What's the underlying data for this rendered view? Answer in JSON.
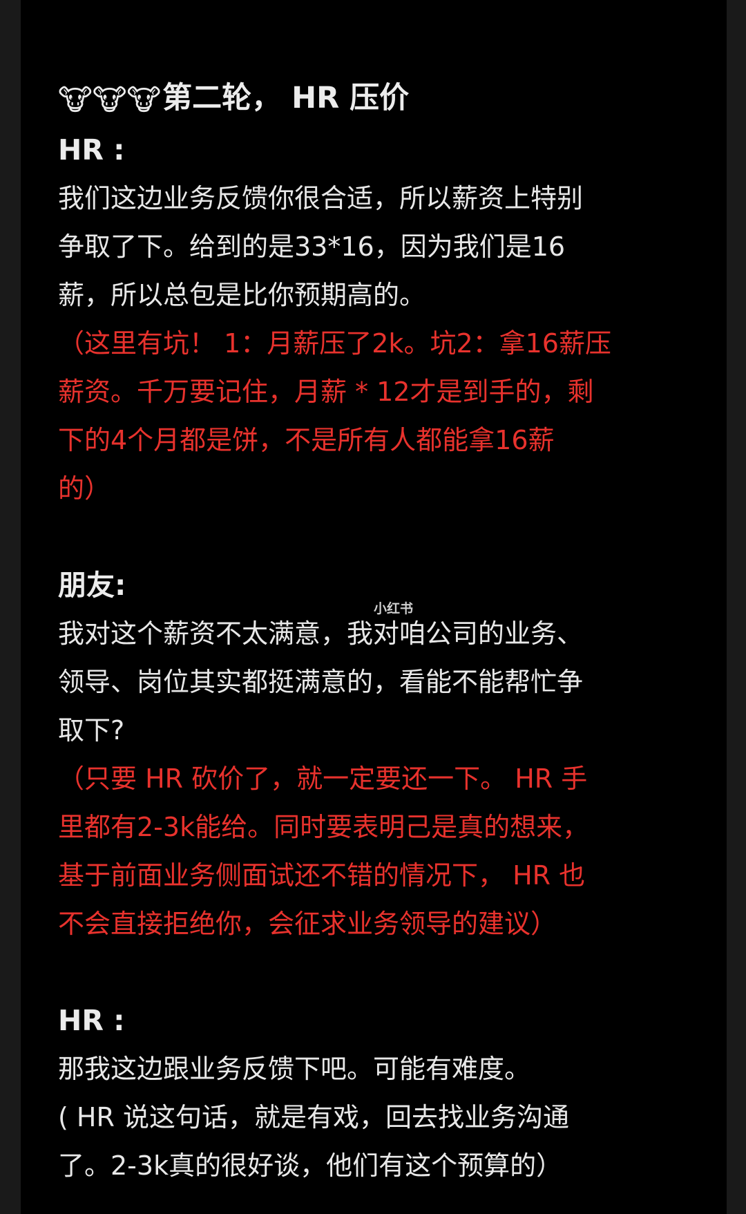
{
  "title": {
    "emoji": "🐮🐮🐮",
    "text": "第二轮， HR 压价"
  },
  "watermark": "小红书",
  "sections": {
    "hr1": {
      "speaker": "HR :",
      "lines": [
        "我们这边业务反馈你很合适，所以薪资上特别",
        "争取了下。给到的是33*16，因为我们是16",
        "薪，所以总包是比你预期高的。"
      ],
      "note": [
        "（这里有坑！ 1：月薪压了2k。坑2：拿16薪压",
        "薪资。千万要记住，月薪 * 12才是到手的，剩",
        "下的4个月都是饼，不是所有人都能拿16薪",
        "的）"
      ]
    },
    "friend": {
      "speaker": "朋友:",
      "lines": [
        "我对这个薪资不太满意，我对咱公司的业务、",
        "领导、岗位其实都挺满意的，看能不能帮忙争",
        "取下?"
      ],
      "note": [
        "（只要 HR 砍价了，就一定要还一下。 HR 手",
        "里都有2-3k能给。同时要表明己是真的想来，",
        "基于前面业务侧面试还不错的情况下， HR 也",
        "不会直接拒绝你，会征求业务领导的建议）"
      ]
    },
    "hr2": {
      "speaker": "HR :",
      "lines": [
        "那我这边跟业务反馈下吧。可能有难度。",
        "( HR 说这句话，就是有戏，回去找业务沟通",
        "了。2-3k真的很好谈，他们有这个预算的）"
      ]
    }
  },
  "colors": {
    "background": "#000000",
    "text": "#e8e8e8",
    "highlight": "#e8322d"
  }
}
